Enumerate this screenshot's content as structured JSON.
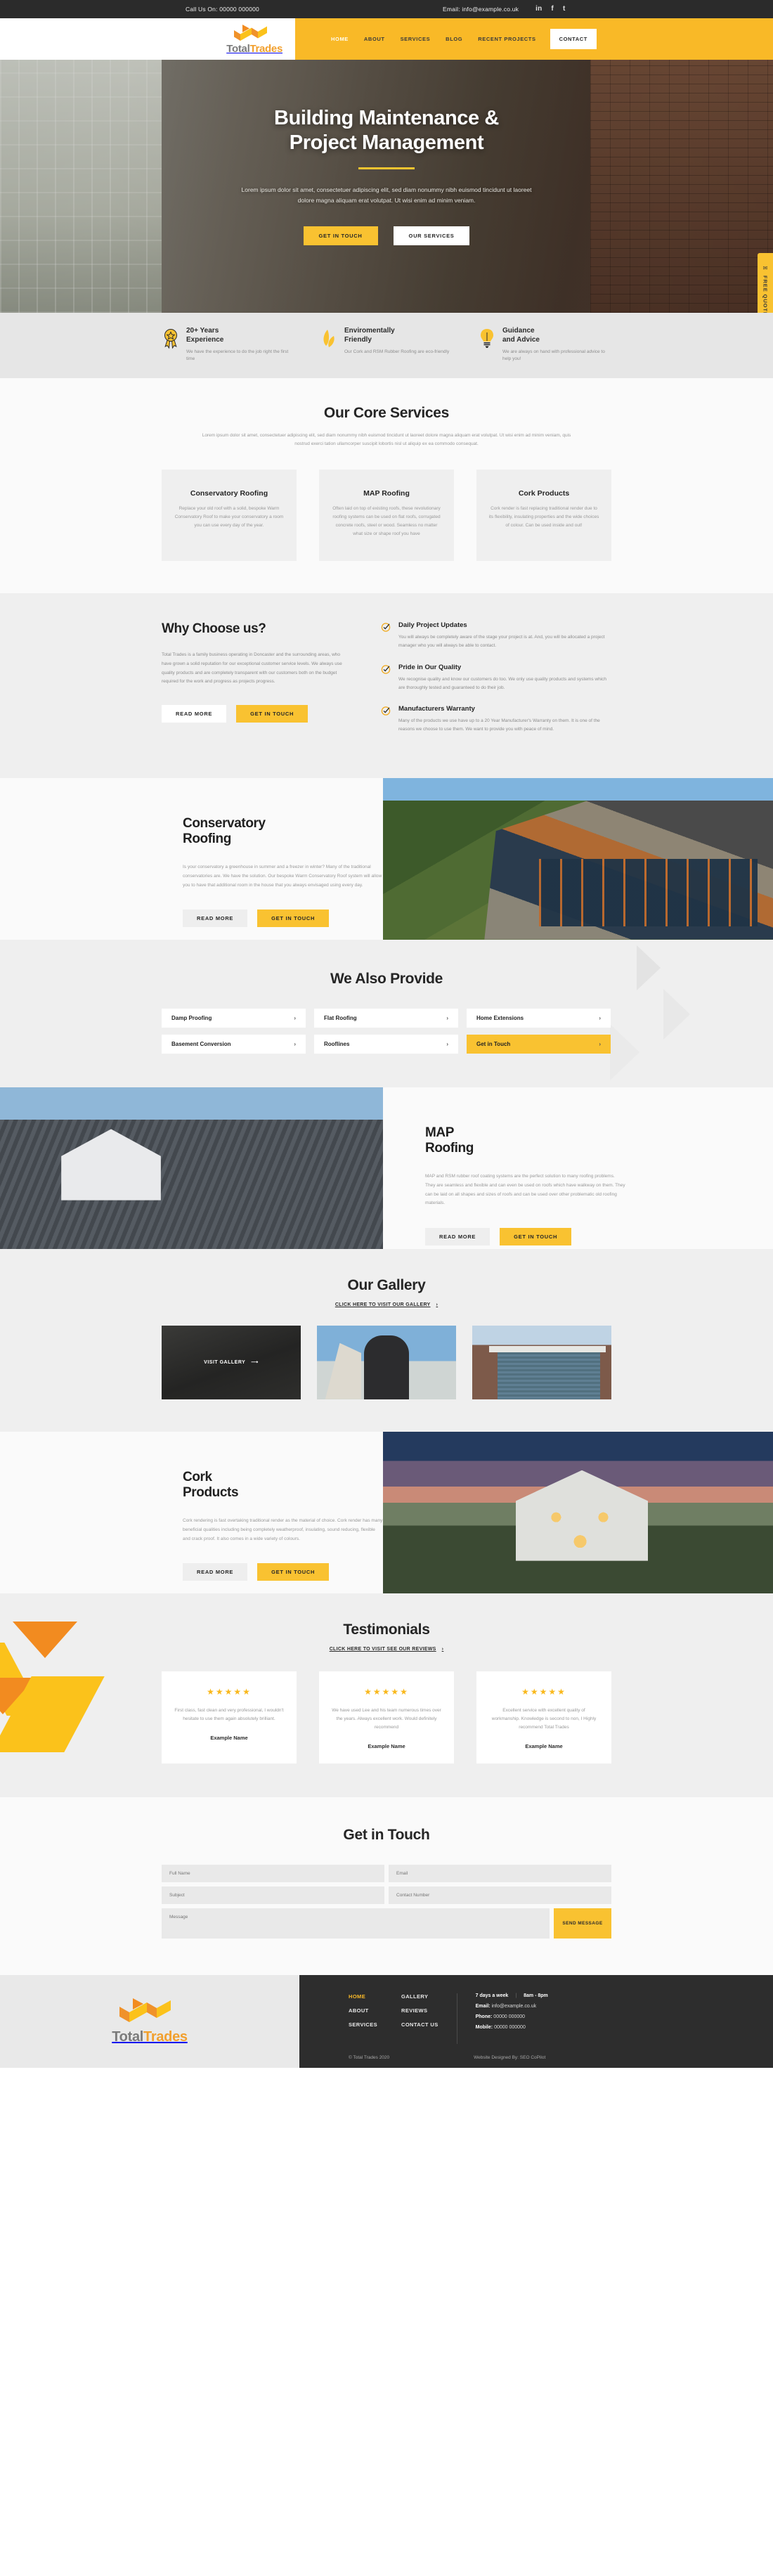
{
  "topbar": {
    "phone": "Call Us On: 00000 000000",
    "email": "Email: info@example.co.uk",
    "socials": [
      "in",
      "f",
      "t"
    ]
  },
  "brand": {
    "name_part1": "Total",
    "name_part2": "Trades"
  },
  "nav": {
    "items": [
      "HOME",
      "ABOUT",
      "SERVICES",
      "BLOG",
      "RECENT PROJECTS"
    ],
    "contact": "CONTACT"
  },
  "quote_tab": {
    "label": "FREE QUOTE",
    "icon": "envelope-icon"
  },
  "hero": {
    "title_line1": "Building Maintenance &",
    "title_line2": "Project Management",
    "body": "Lorem ipsum dolor sit amet, consectetuer adipiscing elit, sed diam nonummy nibh euismod tincidunt ut laoreet dolore magna aliquam erat volutpat. Ut wisi enim ad minim veniam.",
    "btn_primary": "GET IN TOUCH",
    "btn_secondary": "OUR SERVICES"
  },
  "features": [
    {
      "icon": "award-ribbon-icon",
      "title": "20+ Years\nExperience",
      "text": "We have the experience to do the job right the first time"
    },
    {
      "icon": "leaf-icon",
      "title": "Enviromentally\nFriendly",
      "text": "Our Cork and RSM Rubber Roofing are eco-friendly"
    },
    {
      "icon": "lightbulb-icon",
      "title": "Guidance\nand Advice",
      "text": "We are always on hand with professional advice to help you!"
    }
  ],
  "core": {
    "title": "Our Core Services",
    "lead": "Lorem ipsum dolor sit amet, consectetuer adipiscing elit, sed diam nonummy nibh euismod tincidunt ut laoreet dolore magna aliquam erat volutpat. Ut wisi enim ad minim veniam, quis nostrud exerci tation ullamcorper suscipit lobortis nisl ut aliquip ex ea commodo consequat.",
    "cards": [
      {
        "title": "Conservatory Roofing",
        "text": "Replace your old roof with a solid, bespoke Warm Conservatory Roof to make your conservatory a room you can use every day of the year."
      },
      {
        "title": "MAP Roofing",
        "text": "Often laid on top of existing roofs, these revolutionary roofing systems can be used on flat roofs, corrugated concrete roofs, steel or wood. Seamless no matter what size or shape roof you have"
      },
      {
        "title": "Cork Products",
        "text": "Cork render is fast replacing traditional render due to its flexibility, insulating properties and the wide choices of colour. Can be used inside and out!"
      }
    ]
  },
  "why": {
    "title": "Why Choose us?",
    "text": "Total Trades is a family business operating in Doncaster and the surrounding areas, who have grown a solid reputation for our exceptional customer service levels. We always use quality products and are completely transparent with our customers both on the budget required for the work and progress as projects progress.",
    "btn_read": "READ MORE",
    "btn_contact": "GET IN TOUCH",
    "points": [
      {
        "icon": "check-circle-icon",
        "title": "Daily Project Updates",
        "text": "You will always be completely aware of the stage your project is at. And, you will be allocated a project manager who you will always be able to contact."
      },
      {
        "icon": "check-circle-icon",
        "title": "Pride in Our Quality",
        "text": "We recognise quality and know our customers do too. We only use quality products and systems which are thoroughly tested and guaranteed to do their job."
      },
      {
        "icon": "check-circle-icon",
        "title": "Manufacturers Warranty",
        "text": "Many of the products we use have up to a 20 Year Manufacturer's Warranty on them. It is one of the reasons we choose to use them. We want to provide you with peace of mind."
      }
    ]
  },
  "conservatory": {
    "title_line1": "Conservatory",
    "title_line2": "Roofing",
    "text": "Is your conservatory a greenhouse in summer and a freezer in winter? Many of the traditional conservatories are. We have the solution. Our bespoke Warm Conservatory Roof system will allow you to have that additional room in the house that you always envisaged using every day.",
    "btn_read": "READ MORE",
    "btn_contact": "GET IN TOUCH"
  },
  "also": {
    "title": "We Also Provide",
    "items": [
      {
        "label": "Damp Proofing",
        "highlight": false
      },
      {
        "label": "Flat Roofing",
        "highlight": false
      },
      {
        "label": "Home Extensions",
        "highlight": false
      },
      {
        "label": "Basement Conversion",
        "highlight": false
      },
      {
        "label": "Rooflines",
        "highlight": false
      },
      {
        "label": "Get in Touch",
        "highlight": true
      }
    ]
  },
  "map": {
    "title_line1": "MAP",
    "title_line2": "Roofing",
    "text": "MAP and RSM rubber roof coating systems are the perfect solution to many roofing problems. They are seamless and flexible and can even be used on roofs which have walkway on them. They can be laid on all shapes and sizes of roofs and can be used over other problematic old roofing materials.",
    "btn_read": "READ MORE",
    "btn_contact": "GET IN TOUCH"
  },
  "gallery": {
    "title": "Our Gallery",
    "subtitle": "CLICK HERE TO VISIT OUR GALLERY",
    "visit_label": "VISIT GALLERY"
  },
  "cork": {
    "title_line1": "Cork",
    "title_line2": "Products",
    "text": "Cork rendering is fast overtaking traditional render as the material of choice. Cork render has many beneficial qualities including being completely weatherproof, insulating, sound reducing, flexible and crack proof. It also comes in a wide variety of colours.",
    "btn_read": "READ MORE",
    "btn_contact": "GET IN TOUCH"
  },
  "testimonials": {
    "title": "Testimonials",
    "subtitle": "CLICK HERE TO VISIT SEE OUR REVIEWS",
    "stars": "★★★★★",
    "cards": [
      {
        "text": "First class, fast clean and very professional, I wouldn't hesitate to use them again absolutely brilliant.",
        "name": "Example Name"
      },
      {
        "text": "We have used Lee and his team numerous times over the years. Always excellent work. Would definitely recommend",
        "name": "Example Name"
      },
      {
        "text": "Excellent service with excellent quality of workmanship. Knowledge is second to non, I Highly recommend Total Trades",
        "name": "Example Name"
      }
    ]
  },
  "contact": {
    "title": "Get in Touch",
    "full_name_placeholder": "Full Name",
    "email_placeholder": "Email",
    "subject_placeholder": "Subject",
    "contact_number_placeholder": "Contact Number",
    "message_placeholder": "Message",
    "send_label": "SEND MESSAGE"
  },
  "footer": {
    "nav_col1": [
      "HOME",
      "ABOUT",
      "SERVICES"
    ],
    "nav_col2": [
      "GALLERY",
      "REVIEWS",
      "CONTACT US"
    ],
    "hours_days": "7 days a week",
    "hours_time": "8am - 8pm",
    "email_label": "Email:",
    "email_value": "info@example.co.uk",
    "phone_label": "Phone:",
    "phone_value": "00000 000000",
    "mobile_label": "Mobile:",
    "mobile_value": "00000 000000",
    "copyright": "© Total Trades 2020",
    "designer": "Website Designed By: SEO CoPilot"
  },
  "colors": {
    "accent": "#f9c231",
    "accent_dark": "#f28b20",
    "dark": "#2d2d2d",
    "grey_bg": "#efefef"
  }
}
